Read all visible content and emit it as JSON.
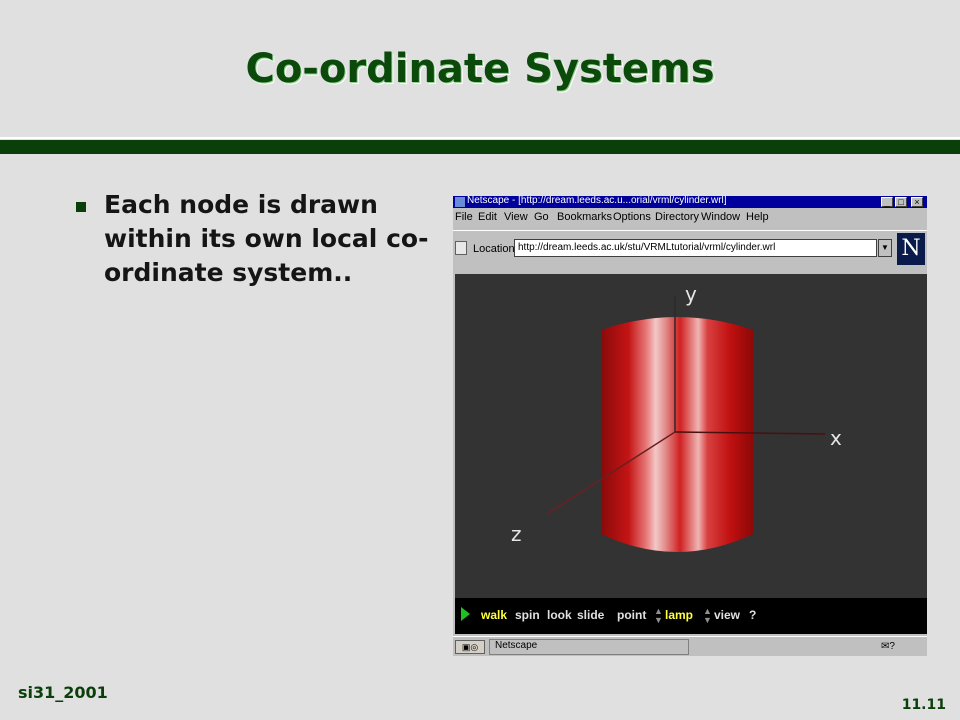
{
  "slide": {
    "title": "Co-ordinate Systems",
    "bullet": "Each node is drawn within its own local co-ordinate system..",
    "footer_left": "si31_2001",
    "footer_right": "11.11"
  },
  "browser": {
    "window_title": "Netscape - [http://dream.leeds.ac.u...orial/vrml/cylinder.wrl]",
    "window_buttons": [
      "_",
      "□",
      "×"
    ],
    "menus": [
      "File",
      "Edit",
      "View",
      "Go",
      "Bookmarks",
      "Options",
      "Directory",
      "Window",
      "Help"
    ],
    "location_label": "Location:",
    "location_url": "http://dream.leeds.ac.uk/stu/VRMLtutorial/vrml/cylinder.wrl",
    "logo_letter": "N",
    "axes": {
      "x": "x",
      "y": "y",
      "z": "z"
    },
    "nav": {
      "walk": "walk",
      "spin": "spin",
      "look": "look",
      "slide": "slide",
      "point": "point",
      "lamp": "lamp",
      "view": "view",
      "help": "?"
    },
    "status_text": "Netscape"
  },
  "colors": {
    "title_green": "#0c4a0c",
    "bar_green": "#0a3f0a",
    "background": "#e0e0e0",
    "cylinder_red": "#c81414",
    "viewport_bg": "#333333",
    "nav_active": "#ffff40"
  }
}
